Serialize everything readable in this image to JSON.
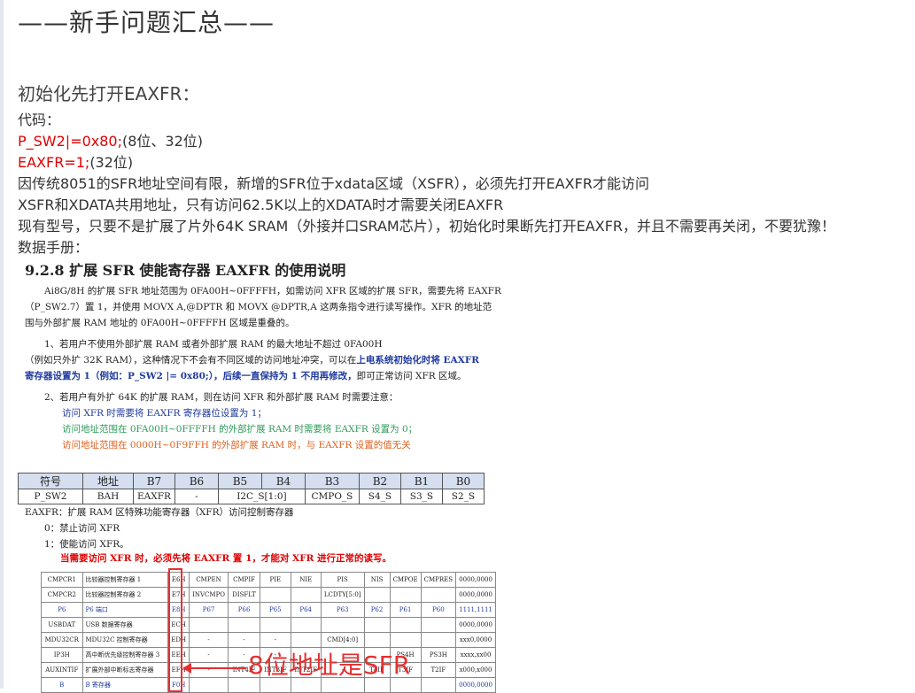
{
  "title": "——新手问题汇总——",
  "section_heading": "初始化先打开EAXFR：",
  "lines": {
    "code_label": "代码：",
    "line1_red": "P_SW2|=0x80;",
    "line1_rest": "(8位、32位)",
    "line2_red": "EAXFR=1;",
    "line2_rest": "(32位)",
    "para1": "因传统8051的SFR地址空间有限，新增的SFR位于xdata区域（XSFR），必须先打开EAXFR才能访问",
    "para2": "XSFR和XDATA共用地址，只有访问62.5K以上的XDATA时才需要关闭EAXFR",
    "para3": "现有型号，只要不是扩展了片外64K SRAM（外接并口SRAM芯片），初始化时果断先打开EAXFR，并且不需要再关闭，不要犹豫！",
    "manual_label": "数据手册："
  },
  "manual": {
    "heading": "9.2.8   扩展 SFR 使能寄存器 EAXFR 的使用说明",
    "p1a": "Ai8G/8H 的扩展 SFR 地址范围为 0FA00H~0FFFFH，如需访问 XFR 区域的扩展 SFR，需要先将 EAXFR",
    "p1b": "（P_SW2.7）置 1，并使用 MOVX A,@DPTR 和 MOVX @DPTR,A 这两条指令进行读写操作。XFR 的地址范",
    "p1c": "围与外部扩展 RAM 地址的 0FA00H~0FFFFH 区域是重叠的。",
    "p2a": "1、若用户不使用外部扩展 RAM 或者外部扩展 RAM 的最大地址不超过 0FA00H",
    "p2b_pre": "（例如只外扩 32K RAM），这种情况下不会有不同区域的访问地址冲突，可以在",
    "p2b_blue": "上电系统初始化时将 EAXFR",
    "p2c_blue": "寄存器设置为 1（例如：P_SW2 |= 0x80;），后续一直保持为 1 不用再修改，",
    "p2c_post": "即可正常访问 XFR 区域。",
    "p3a": "2、若用户有外扩 64K 的扩展 RAM，则在访问 XFR 和外部扩展 RAM 时需要注意：",
    "p3b": "访问 XFR 时需要将 EAXFR 寄存器位设置为 1；",
    "p3c": "访问地址范围在 0FA00H~0FFFFH 的外部扩展 RAM 时需要将 EAXFR 设置为 0；",
    "p3d": "访问地址范围在 0000H~0F9FFH 的外部扩展 RAM 时，与 EAXFR 设置的值无关",
    "reg_header": [
      "符号",
      "地址",
      "B7",
      "B6",
      "B5",
      "B4",
      "B3",
      "B2",
      "B1",
      "B0"
    ],
    "reg_row": [
      "P_SW2",
      "BAH",
      "EAXFR",
      "-",
      "I2C_S[1:0]",
      "CMPO_S",
      "S4_S",
      "S3_S",
      "S2_S"
    ],
    "desc1": "EAXFR：扩展 RAM 区特殊功能寄存器（XFR）访问控制寄存器",
    "desc2": "0：禁止访问 XFR",
    "desc3": "1：使能访问 XFR。",
    "desc4": "当需要访问 XFR 时，必须先将 EAXFR 置 1，才能对 XFR 进行正常的读写。"
  },
  "sfr_table": [
    [
      "CMPCR1",
      "比较器控制寄存器 1",
      "E6H",
      "CMPEN",
      "CMPIF",
      "PIE",
      "NIE",
      "PIS",
      "NIS",
      "CMPOE",
      "CMPRES",
      "0000,0000"
    ],
    [
      "CMPCR2",
      "比较器控制寄存器 2",
      "E7H",
      "INVCMPO",
      "DISFLT",
      "",
      "",
      "LCDTY[5:0]",
      "",
      "",
      "",
      "0000,0000"
    ],
    [
      "P6",
      "P6 端口",
      "E8H",
      "P67",
      "P66",
      "P65",
      "P64",
      "P63",
      "P62",
      "P61",
      "P60",
      "1111,1111"
    ],
    [
      "USBDAT",
      "USB 数据寄存器",
      "ECH",
      "",
      "",
      "",
      "",
      "",
      "",
      "",
      "",
      "0000,0000"
    ],
    [
      "MDU32CR",
      "MDU32C 控制寄存器",
      "EDH",
      "-",
      "-",
      "-",
      "",
      "CMD[4:0]",
      "",
      "",
      "",
      "xxx0,0000"
    ],
    [
      "IP3H",
      "高中断优先级控制寄存器 3",
      "EEH",
      "-",
      "-",
      "-",
      "-",
      "",
      "",
      "PS4H",
      "PS3H",
      "xxxx,xx00"
    ],
    [
      "AUXINTIF",
      "扩展外部中断标志寄存器",
      "EFH",
      "-",
      "INT4IF",
      "INT3IF",
      "INT2IF",
      "-",
      "T4IF",
      "T3IF",
      "T2IF",
      "x000,x000"
    ],
    [
      "B",
      "B 寄存器",
      "F0H",
      "",
      "",
      "",
      "",
      "",
      "",
      "",
      "",
      "0000,0000"
    ]
  ],
  "annotation": "8位地址是SFR",
  "colors": {
    "red": "#e00000",
    "blue": "#1f3a9e",
    "green": "#2e9b5a",
    "orange": "#e0601e",
    "annot": "#e53030"
  }
}
